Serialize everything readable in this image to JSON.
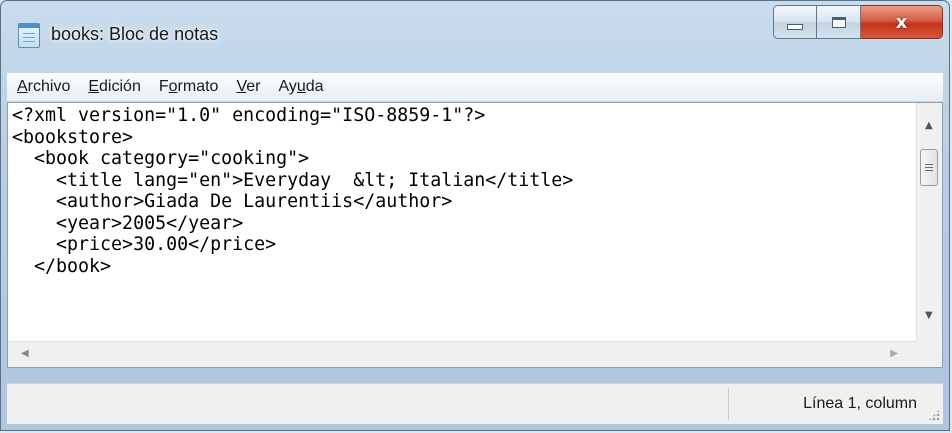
{
  "window": {
    "title": "books: Bloc de notas",
    "icon": "notepad-icon",
    "close_symbol": "x"
  },
  "menu": [
    {
      "mnemonic": "A",
      "rest": "rchivo"
    },
    {
      "mnemonic": "E",
      "rest": "dición"
    },
    {
      "pre": "F",
      "mnemonic": "o",
      "rest": "rmato"
    },
    {
      "mnemonic": "V",
      "rest": "er"
    },
    {
      "pre": "Ay",
      "mnemonic": "u",
      "rest": "da"
    }
  ],
  "editor": {
    "lines": [
      "<?xml version=\"1.0\" encoding=\"ISO-8859-1\"?>",
      "<bookstore>",
      "  <book category=\"cooking\">",
      "    <title lang=\"en\">Everyday  &lt; Italian</title>",
      "    <author>Giada De Laurentiis</author>",
      "    <year>2005</year>",
      "    <price>30.00</price>",
      "  </book>"
    ]
  },
  "statusbar": {
    "position": "Línea 1, column"
  },
  "colors": {
    "frame": "#b7cde3",
    "close_button": "#c2351c",
    "editor_bg": "#ffffff"
  }
}
